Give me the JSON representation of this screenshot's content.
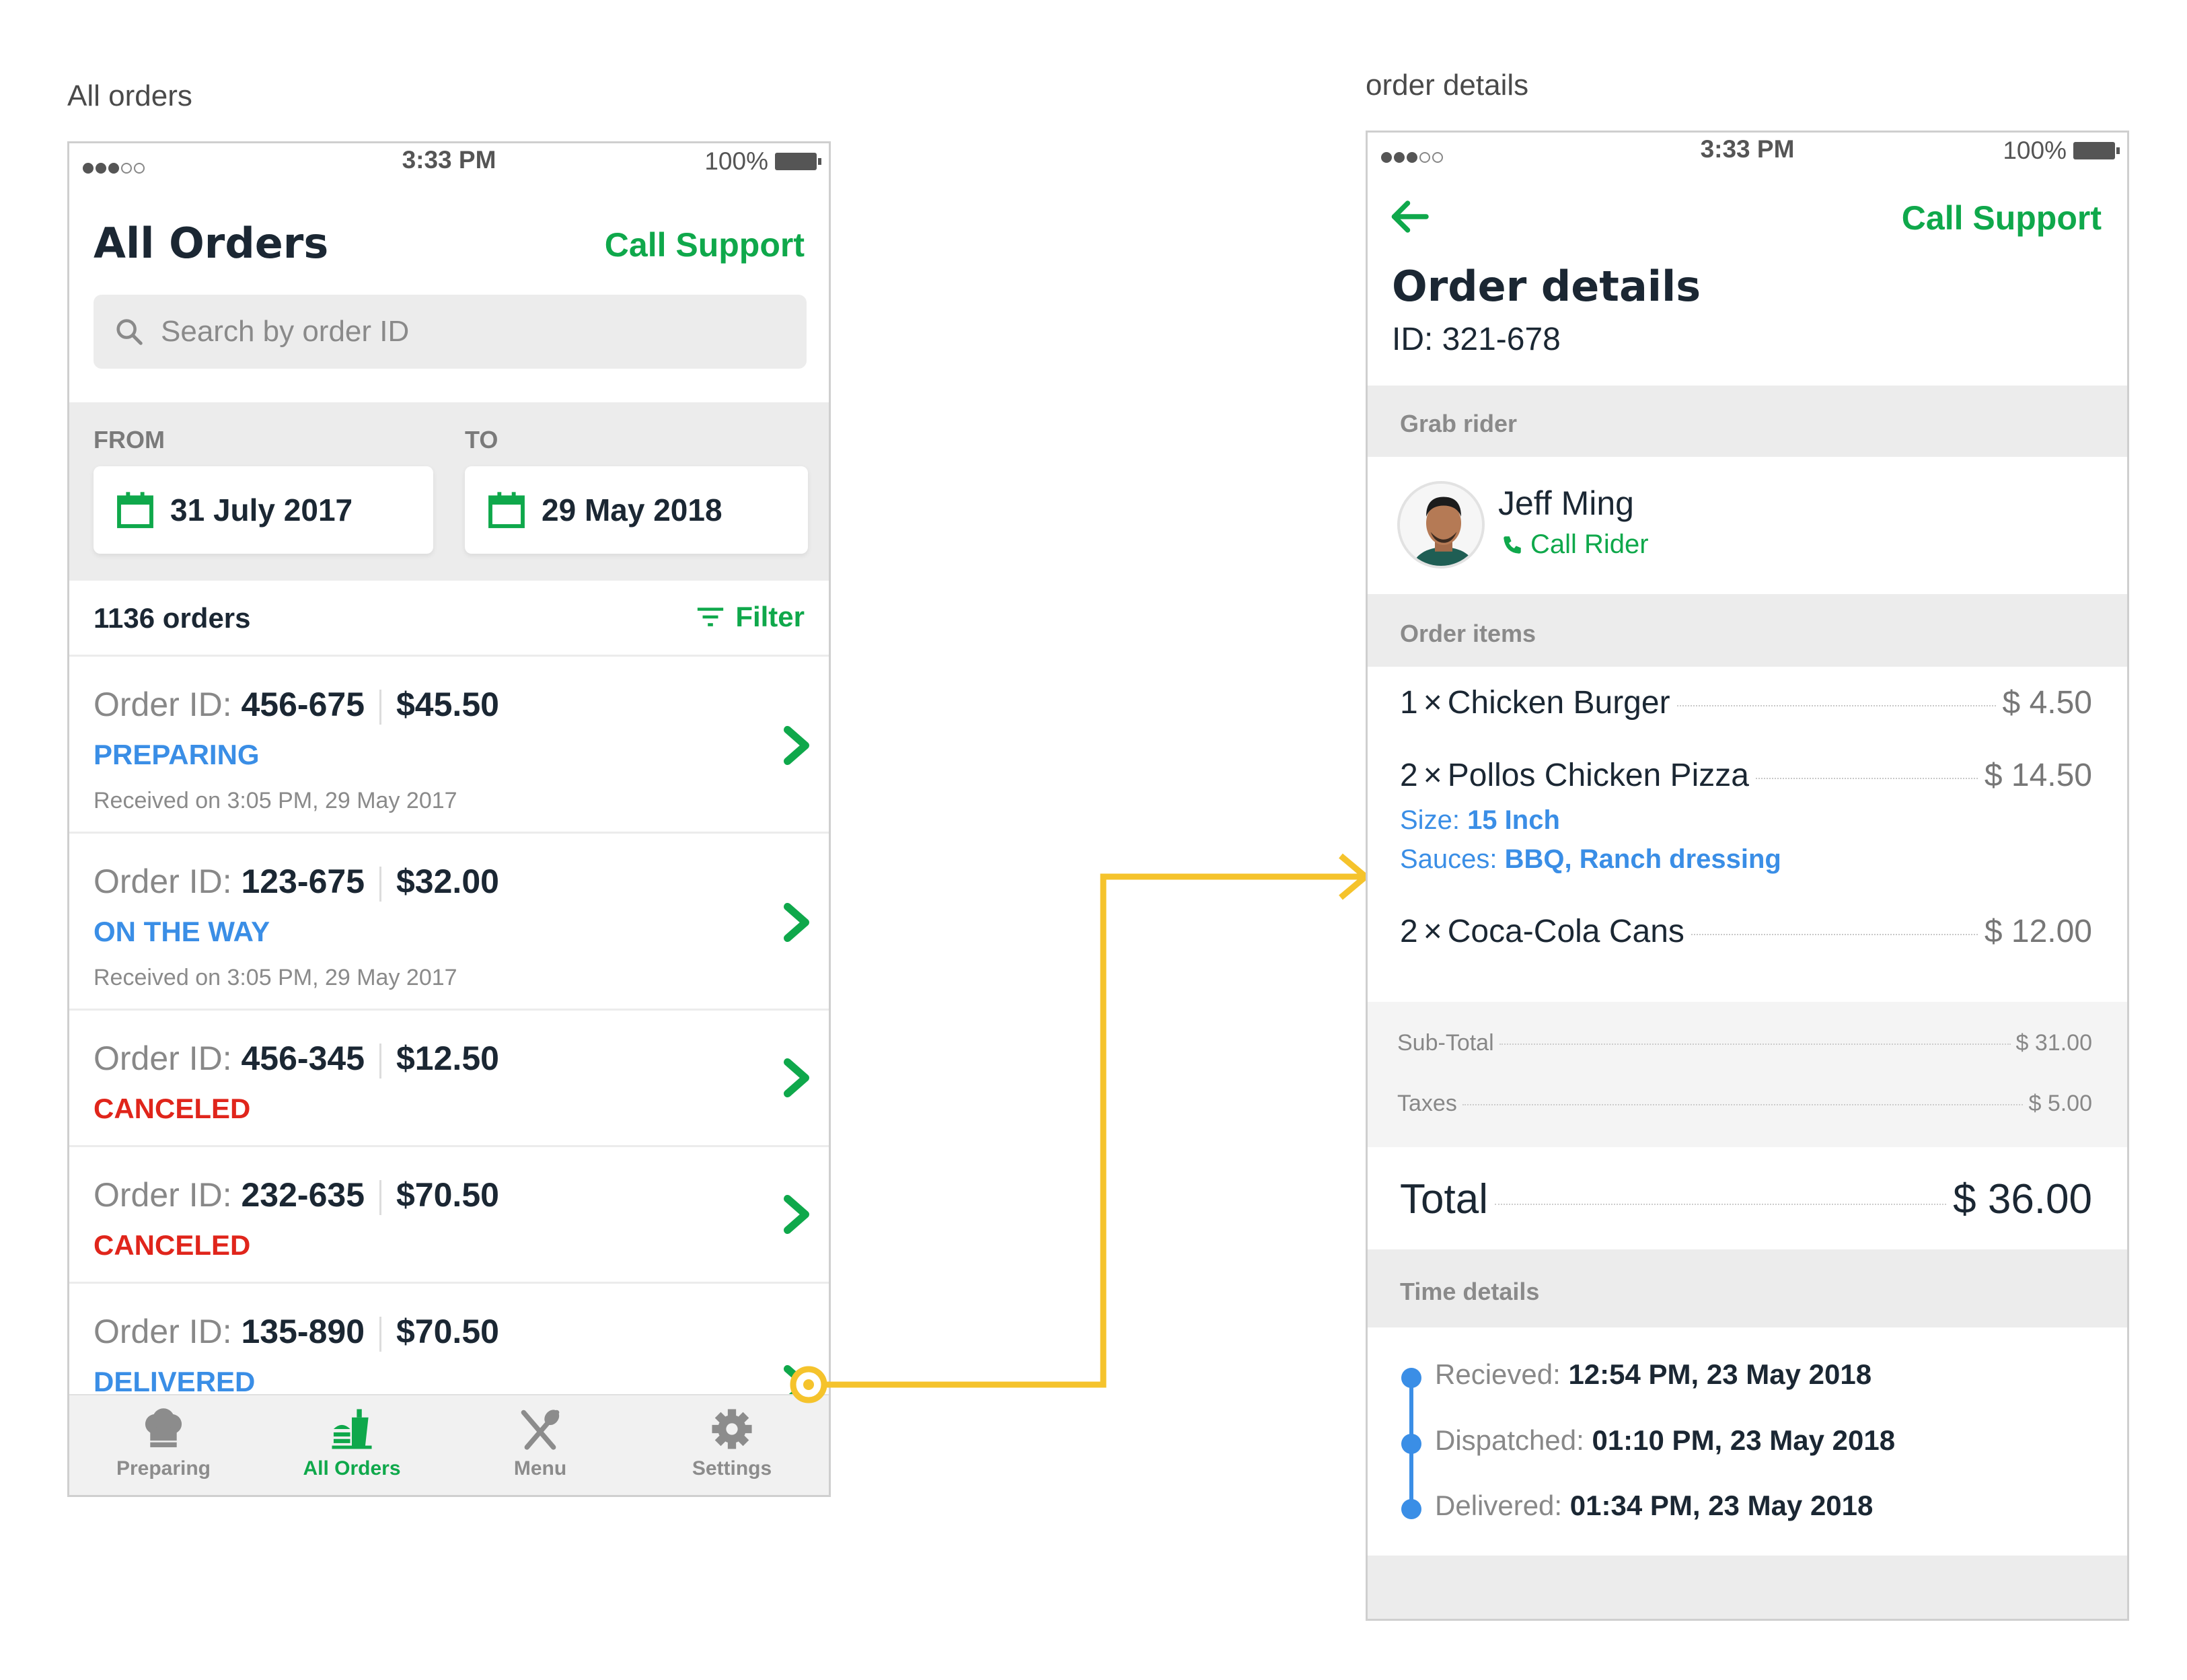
{
  "captions": {
    "left": "All orders",
    "right": "order details"
  },
  "colors": {
    "accent_green": "#0fa84b",
    "status_blue": "#3a8ee6",
    "status_red": "#e0251b",
    "connector_yellow": "#f5c32c"
  },
  "status_bar": {
    "time": "3:33 PM",
    "battery": "100%"
  },
  "all_orders": {
    "title": "All Orders",
    "call_support": "Call Support",
    "search_placeholder": "Search by order ID",
    "from_label": "FROM",
    "to_label": "TO",
    "from_date": "31 July 2017",
    "to_date": "29 May 2018",
    "count": "1136 orders",
    "filter": "Filter",
    "order_id_prefix": "Order ID:",
    "orders": [
      {
        "id": "456-675",
        "amount": "$45.50",
        "status": "PREPARING",
        "received": "Received on 3:05 PM, 29 May 2017"
      },
      {
        "id": "123-675",
        "amount": "$32.00",
        "status": "ON THE WAY",
        "received": "Received on 3:05 PM, 29 May 2017"
      },
      {
        "id": "456-345",
        "amount": "$12.50",
        "status": "CANCELED"
      },
      {
        "id": "232-635",
        "amount": "$70.50",
        "status": "CANCELED"
      },
      {
        "id": "135-890",
        "amount": "$70.50",
        "status": "DELIVERED"
      }
    ],
    "tabs": [
      {
        "label": "Preparing",
        "icon": "chef-hat-icon"
      },
      {
        "label": "All Orders",
        "icon": "food-tray-icon"
      },
      {
        "label": "Menu",
        "icon": "fork-knife-icon"
      },
      {
        "label": "Settings",
        "icon": "gear-icon"
      }
    ]
  },
  "order_details": {
    "call_support": "Call Support",
    "title": "Order details",
    "id_line": "ID: 321-678",
    "rider_section": "Grab rider",
    "rider_name": "Jeff Ming",
    "call_rider": "Call Rider",
    "items_section": "Order items",
    "items": [
      {
        "qty": "1",
        "name": "Chicken Burger",
        "price": "$ 4.50"
      },
      {
        "qty": "2",
        "name": "Pollos Chicken Pizza",
        "price": "$ 14.50"
      },
      {
        "qty": "2",
        "name": "Coca-Cola Cans",
        "price": "$ 12.00"
      }
    ],
    "item_times": "×",
    "size_label": "Size:",
    "size_value": "15 Inch",
    "sauces_label": "Sauces:",
    "sauces_value": "BBQ, Ranch dressing",
    "subtotal_label": "Sub-Total",
    "subtotal_value": "$ 31.00",
    "taxes_label": "Taxes",
    "taxes_value": "$ 5.00",
    "total_label": "Total",
    "total_value": "$ 36.00",
    "time_section": "Time details",
    "times": [
      {
        "label": "Recieved:",
        "value": "12:54 PM, 23 May 2018"
      },
      {
        "label": "Dispatched:",
        "value": "01:10 PM, 23 May 2018"
      },
      {
        "label": "Delivered:",
        "value": "01:34 PM, 23 May 2018"
      }
    ]
  }
}
